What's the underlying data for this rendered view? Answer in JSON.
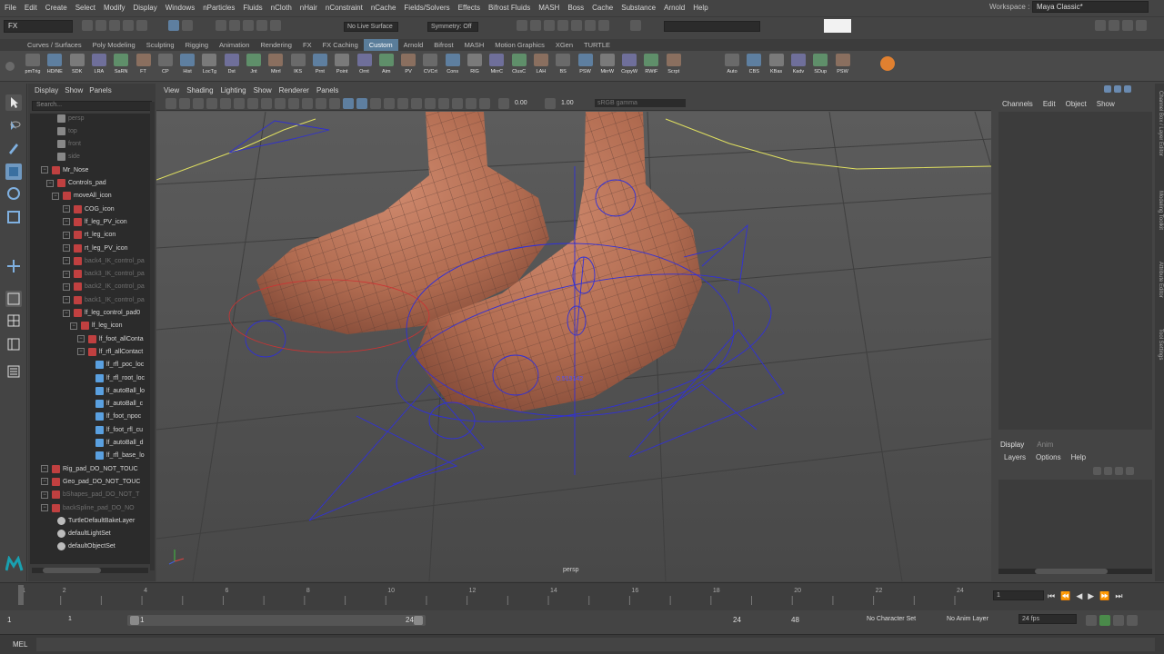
{
  "menubar": {
    "items": [
      "File",
      "Edit",
      "Create",
      "Select",
      "Modify",
      "Display",
      "Windows",
      "nParticles",
      "Fluids",
      "nCloth",
      "nHair",
      "nConstraint",
      "nCache",
      "Fields/Solvers",
      "Effects",
      "Bifrost Fluids",
      "MASH",
      "Boss",
      "Cache",
      "Substance",
      "Arnold",
      "Help"
    ],
    "workspace_label": "Workspace :",
    "workspace_value": "Maya Classic*"
  },
  "statusline": {
    "mode": "FX",
    "live_surface": "No Live Surface",
    "symmetry": "Symmetry: Off"
  },
  "shelf": {
    "tabs": [
      "Curves / Surfaces",
      "Poly Modeling",
      "Sculpting",
      "Rigging",
      "Animation",
      "Rendering",
      "FX",
      "FX Caching",
      "Custom",
      "Arnold",
      "Bifrost",
      "MASH",
      "Motion Graphics",
      "XGen",
      "TURTLE"
    ],
    "active_tab": "Custom",
    "buttons": [
      "pmTrig",
      "HD/NE",
      "SDK",
      "LRA",
      "SaRN",
      "FT",
      "CP",
      "Hist",
      "LocTg",
      "Dst",
      "Jnt",
      "Mirrl",
      "IKS",
      "Prnt",
      "Point",
      "Ornt",
      "Aim",
      "PV",
      "CVCrt",
      "Cons",
      "RlG",
      "MirrC",
      "ClusC",
      "LAH",
      "BS",
      "PSW",
      "MirrW",
      "CopyW",
      "RWtF",
      "Scrpt",
      "Auto",
      "CBS",
      "KBas",
      "Kadv",
      "SDup",
      "PSW"
    ]
  },
  "outliner": {
    "menu": [
      "Display",
      "Show",
      "Panels"
    ],
    "search_placeholder": "Search...",
    "rows": [
      {
        "label": "persp",
        "dim": true
      },
      {
        "label": "top",
        "dim": true
      },
      {
        "label": "front",
        "dim": true
      },
      {
        "label": "side",
        "dim": true
      },
      {
        "label": "Mr_Nose",
        "dim": false
      },
      {
        "label": "Controls_pad",
        "dim": false
      },
      {
        "label": "moveAll_icon",
        "dim": false
      },
      {
        "label": "COG_icon",
        "dim": false
      },
      {
        "label": "lf_leg_PV_icon",
        "dim": false
      },
      {
        "label": "rt_leg_icon",
        "dim": false
      },
      {
        "label": "rt_leg_PV_icon",
        "dim": false
      },
      {
        "label": "back4_IK_control_pa",
        "dim": true
      },
      {
        "label": "back3_IK_control_pa",
        "dim": true
      },
      {
        "label": "back2_IK_control_pa",
        "dim": true
      },
      {
        "label": "back1_IK_control_pa",
        "dim": true
      },
      {
        "label": "lf_leg_control_pad0",
        "dim": false
      },
      {
        "label": "lf_leg_icon",
        "dim": false
      },
      {
        "label": "lf_foot_allConta",
        "dim": false
      },
      {
        "label": "lf_rfl_allContact",
        "dim": false
      },
      {
        "label": "lf_rfl_poc_loc",
        "dim": false
      },
      {
        "label": "lf_rfl_root_loc",
        "dim": false
      },
      {
        "label": "lf_autoBall_lo",
        "dim": false
      },
      {
        "label": "lf_autoBall_c",
        "dim": false
      },
      {
        "label": "lf_foot_npoc",
        "dim": false
      },
      {
        "label": "lf_foot_rfl_cu",
        "dim": false
      },
      {
        "label": "lf_autoBall_d",
        "dim": false
      },
      {
        "label": "lf_rfl_base_lo",
        "dim": false
      },
      {
        "label": "Rig_pad_DO_NOT_TOUC",
        "dim": false
      },
      {
        "label": "Geo_pad_DO_NOT_TOUC",
        "dim": false
      },
      {
        "label": "bShapes_pad_DO_NOT_T",
        "dim": true
      },
      {
        "label": "backSpline_pad_DO_NO",
        "dim": true
      },
      {
        "label": "TurtleDefaultBakeLayer",
        "dim": false
      },
      {
        "label": "defaultLightSet",
        "dim": false
      },
      {
        "label": "defaultObjectSet",
        "dim": false
      }
    ]
  },
  "viewport": {
    "menu": [
      "View",
      "Shading",
      "Lighting",
      "Show",
      "Renderer",
      "Panels"
    ],
    "exposure": "0.00",
    "gamma": "1.00",
    "color_space": "sRGB gamma",
    "camera_label": "persp",
    "hud_value": "0.519142"
  },
  "channel_box": {
    "menu": [
      "Channels",
      "Edit",
      "Object",
      "Show"
    ]
  },
  "layer_editor": {
    "tabs": [
      "Display",
      "Anim"
    ],
    "menu": [
      "Layers",
      "Options",
      "Help"
    ]
  },
  "side_tabs": [
    "Channel Box / Layer Editor",
    "Modeling Toolkit",
    "Attribute Editor",
    "Tool Settings"
  ],
  "timeline": {
    "ticks": [
      "1",
      "2",
      "4",
      "6",
      "8",
      "10",
      "12",
      "14",
      "16",
      "18",
      "20",
      "22",
      "24"
    ],
    "current_frame": "1"
  },
  "range": {
    "start": "1",
    "playback_start": "1",
    "slider_start": "1",
    "slider_end": "24",
    "playback_end": "24",
    "end": "48",
    "character_set": "No Character Set",
    "anim_layer": "No Anim Layer",
    "fps": "24 fps"
  },
  "command_line": {
    "language": "MEL"
  }
}
